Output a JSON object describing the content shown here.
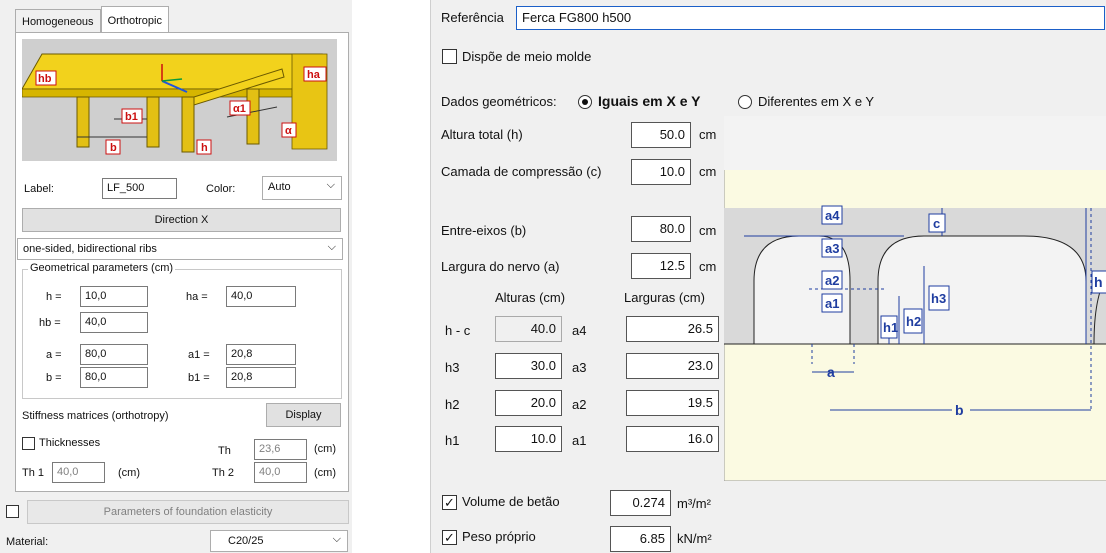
{
  "left": {
    "tabs": [
      "Homogeneous",
      "Orthotropic"
    ],
    "image_labels": {
      "hb": "hb",
      "ha": "ha",
      "b1": "b1",
      "a1": "α1",
      "b": "b",
      "h": "h",
      "a": "α"
    },
    "label_caption": "Label:",
    "label_value": "LF_500",
    "color_caption": "Color:",
    "color_value": "Auto",
    "direction_button": "Direction X",
    "rib_type": "one-sided, bidirectional ribs",
    "geom_group": "Geometrical parameters (cm)",
    "params": [
      {
        "name": "h =",
        "value": "10,0"
      },
      {
        "name": "ha =",
        "value": "40,0"
      },
      {
        "name": "hb =",
        "value": "40,0"
      },
      {
        "name": "a =",
        "value": "80,0"
      },
      {
        "name": "a1 =",
        "value": "20,8"
      },
      {
        "name": "b =",
        "value": "80,0"
      },
      {
        "name": "b1 =",
        "value": "20,8"
      }
    ],
    "stiffness_label": "Stiffness matrices (orthotropy)",
    "display_button": "Display",
    "thicknesses_label": "Thicknesses",
    "th_label": "Th",
    "th_value": "23,6",
    "th_unit": "(cm)",
    "th1_label": "Th 1",
    "th1_value": "40,0",
    "th1_unit": "(cm)",
    "th2_label": "Th 2",
    "th2_value": "40,0",
    "th2_unit": "(cm)",
    "foundation_button": "Parameters of foundation elasticity",
    "material_label": "Material:",
    "material_value": "C20/25"
  },
  "right": {
    "ref_label": "Referência",
    "ref_value": "Ferca FG800 h500",
    "half_mold_label": "Dispõe de meio molde",
    "geom_label": "Dados geométricos:",
    "radio_equal": "Iguais em X e Y",
    "radio_diff": "Diferentes em X e Y",
    "fields": [
      {
        "label": "Altura total (h)",
        "value": "50.0",
        "unit": "cm"
      },
      {
        "label": "Camada de compressão (c)",
        "value": "10.0",
        "unit": "cm"
      },
      {
        "label": "Entre-eixos (b)",
        "value": "80.0",
        "unit": "cm"
      },
      {
        "label": "Largura do nervo (a)",
        "value": "12.5",
        "unit": "cm"
      }
    ],
    "heights_header": "Alturas (cm)",
    "widths_header": "Larguras (cm)",
    "rows": [
      {
        "h": "h - c",
        "hv": "40.0",
        "a": "a4",
        "av": "26.5"
      },
      {
        "h": "h3",
        "hv": "30.0",
        "a": "a3",
        "av": "23.0"
      },
      {
        "h": "h2",
        "hv": "20.0",
        "a": "a2",
        "av": "19.5"
      },
      {
        "h": "h1",
        "hv": "10.0",
        "a": "a1",
        "av": "16.0"
      }
    ],
    "volume_label": "Volume de betão",
    "volume_value": "0.274",
    "volume_unit": "m³/m²",
    "weight_label": "Peso próprio",
    "weight_value": "6.85",
    "weight_unit": "kN/m²",
    "diagram_labels": {
      "a4": "a4",
      "a3": "a3",
      "a2": "a2",
      "a1": "a1",
      "c": "c",
      "h": "h",
      "h3": "h3",
      "h2": "h2",
      "h1": "h1",
      "a": "a",
      "b": "b"
    }
  },
  "colors": {
    "accent_red": "#cc1010",
    "beam_yellow": "#f2d21c",
    "diagram_cream": "#fbfae2",
    "concrete": "#d9d9d9",
    "dim_blue": "#1f3da0"
  }
}
